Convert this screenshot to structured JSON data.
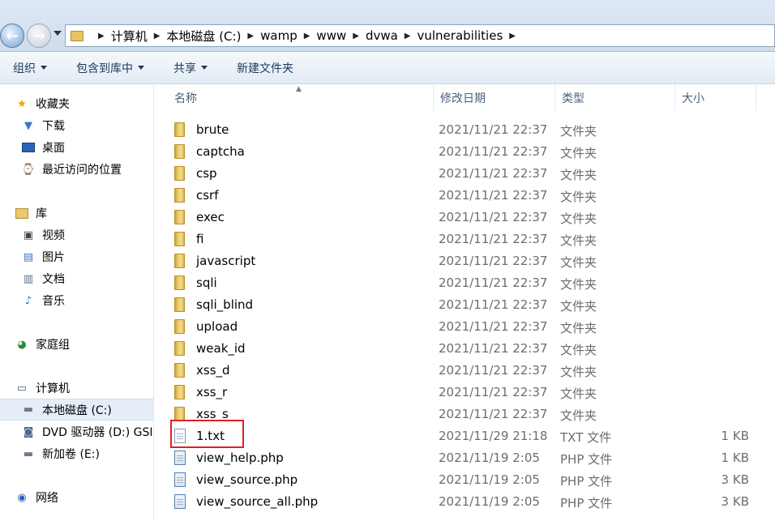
{
  "address": {
    "crumbs": [
      "计算机",
      "本地磁盘 (C:)",
      "wamp",
      "www",
      "dvwa",
      "vulnerabilities"
    ]
  },
  "toolbar": {
    "organize": "组织",
    "include_library": "包含到库中",
    "share": "共享",
    "new_folder": "新建文件夹"
  },
  "sidebar": {
    "favorites": "收藏夹",
    "downloads": "下载",
    "desktop": "桌面",
    "recent": "最近访问的位置",
    "libraries": "库",
    "videos": "视频",
    "pictures": "图片",
    "documents": "文档",
    "music": "音乐",
    "homegroup": "家庭组",
    "computer": "计算机",
    "local_disk": "本地磁盘 (C:)",
    "dvd_drive": "DVD 驱动器 (D:) GSI",
    "new_volume": "新加卷 (E:)",
    "network": "网络"
  },
  "columns": {
    "name": "名称",
    "modified": "修改日期",
    "type": "类型",
    "size": "大小"
  },
  "files": [
    {
      "name": "brute",
      "date": "2021/11/21 22:37",
      "type": "文件夹",
      "size": "",
      "kind": "folder"
    },
    {
      "name": "captcha",
      "date": "2021/11/21 22:37",
      "type": "文件夹",
      "size": "",
      "kind": "folder"
    },
    {
      "name": "csp",
      "date": "2021/11/21 22:37",
      "type": "文件夹",
      "size": "",
      "kind": "folder"
    },
    {
      "name": "csrf",
      "date": "2021/11/21 22:37",
      "type": "文件夹",
      "size": "",
      "kind": "folder"
    },
    {
      "name": "exec",
      "date": "2021/11/21 22:37",
      "type": "文件夹",
      "size": "",
      "kind": "folder"
    },
    {
      "name": "fi",
      "date": "2021/11/21 22:37",
      "type": "文件夹",
      "size": "",
      "kind": "folder"
    },
    {
      "name": "javascript",
      "date": "2021/11/21 22:37",
      "type": "文件夹",
      "size": "",
      "kind": "folder"
    },
    {
      "name": "sqli",
      "date": "2021/11/21 22:37",
      "type": "文件夹",
      "size": "",
      "kind": "folder"
    },
    {
      "name": "sqli_blind",
      "date": "2021/11/21 22:37",
      "type": "文件夹",
      "size": "",
      "kind": "folder"
    },
    {
      "name": "upload",
      "date": "2021/11/21 22:37",
      "type": "文件夹",
      "size": "",
      "kind": "folder"
    },
    {
      "name": "weak_id",
      "date": "2021/11/21 22:37",
      "type": "文件夹",
      "size": "",
      "kind": "folder"
    },
    {
      "name": "xss_d",
      "date": "2021/11/21 22:37",
      "type": "文件夹",
      "size": "",
      "kind": "folder"
    },
    {
      "name": "xss_r",
      "date": "2021/11/21 22:37",
      "type": "文件夹",
      "size": "",
      "kind": "folder"
    },
    {
      "name": "xss_s",
      "date": "2021/11/21 22:37",
      "type": "文件夹",
      "size": "",
      "kind": "folder"
    },
    {
      "name": "1.txt",
      "date": "2021/11/29 21:18",
      "type": "TXT 文件",
      "size": "1 KB",
      "kind": "txt"
    },
    {
      "name": "view_help.php",
      "date": "2021/11/19 2:05",
      "type": "PHP 文件",
      "size": "1 KB",
      "kind": "php"
    },
    {
      "name": "view_source.php",
      "date": "2021/11/19 2:05",
      "type": "PHP 文件",
      "size": "3 KB",
      "kind": "php"
    },
    {
      "name": "view_source_all.php",
      "date": "2021/11/19 2:05",
      "type": "PHP 文件",
      "size": "3 KB",
      "kind": "php"
    }
  ]
}
